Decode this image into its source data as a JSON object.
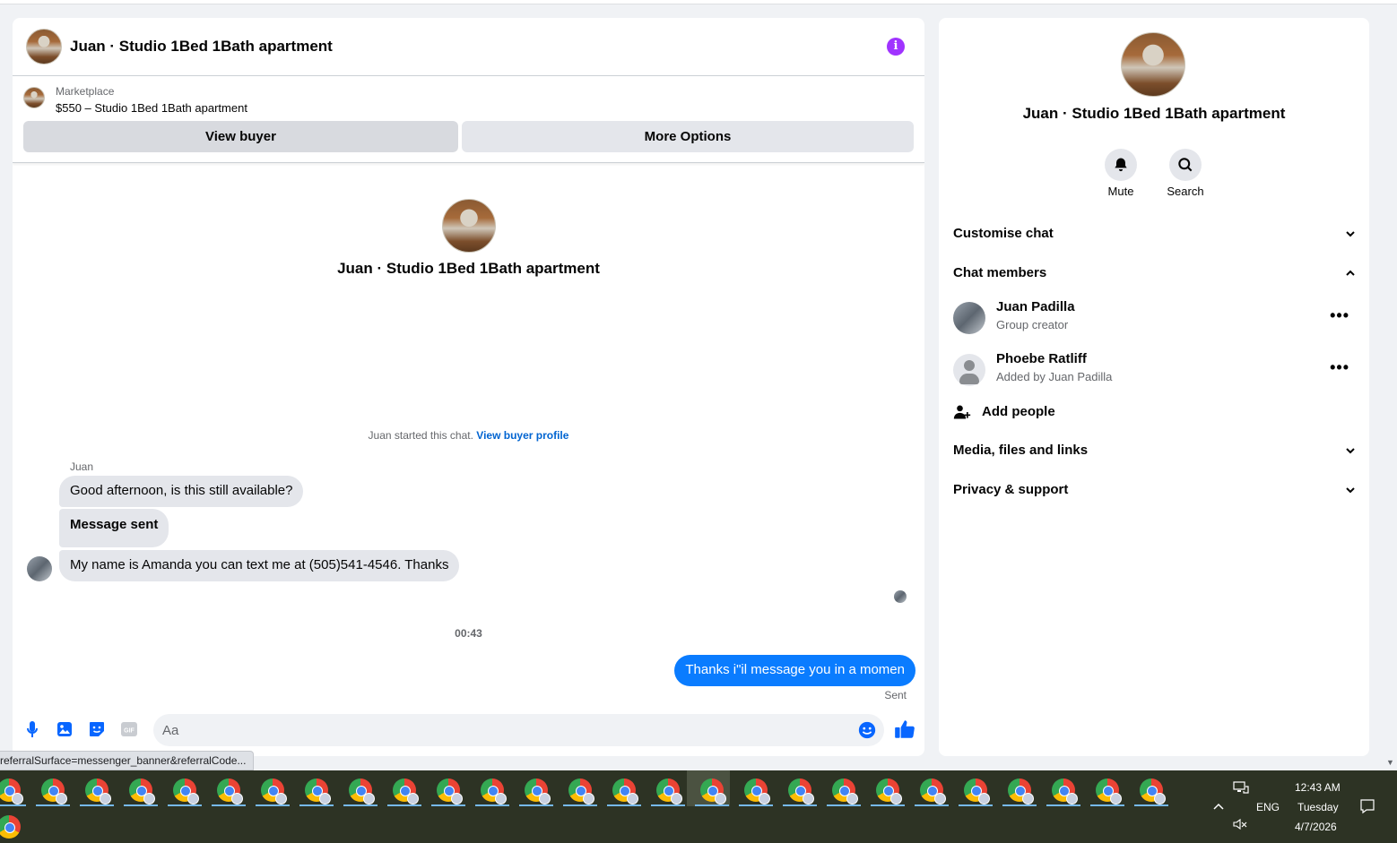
{
  "chat": {
    "title": "Juan · Studio 1Bed 1Bath apartment",
    "info_icon": "i",
    "marketplace_label": "Marketplace",
    "listing": "$550 – Studio 1Bed 1Bath apartment",
    "view_buyer_label": "View buyer",
    "more_options_label": "More Options",
    "intro_title": "Juan · Studio 1Bed 1Bath apartment",
    "started_text": "Juan started this chat.",
    "view_buyer_profile": "View buyer profile",
    "sender_name": "Juan",
    "messages": [
      {
        "text": "Good afternoon, is this still available?"
      },
      {
        "text": "Message sent"
      },
      {
        "text": "My name is Amanda you can text me at (505)541-4546. Thanks"
      }
    ],
    "timestamp": "00:43",
    "outgoing": "Thanks i\"il message you in a momen",
    "sent_label": "Sent",
    "composer_placeholder": "Aa"
  },
  "status_url": "referralSurface=messenger_banner&referralCode...",
  "side": {
    "title": "Juan · Studio 1Bed 1Bath apartment",
    "mute_label": "Mute",
    "search_label": "Search",
    "sections": {
      "customise": "Customise chat",
      "members": "Chat members",
      "media": "Media, files and links",
      "privacy": "Privacy & support"
    },
    "members": [
      {
        "name": "Juan Padilla",
        "sub": "Group creator",
        "more": "•••"
      },
      {
        "name": "Phoebe Ratliff",
        "sub": "Added by Juan Padilla",
        "more": "•••"
      }
    ],
    "add_people": "Add people"
  },
  "taskbar": {
    "lang": "ENG",
    "time": "12:43 AM",
    "day": "Tuesday",
    "date": "4/7/2026"
  },
  "colors": {
    "accent": "#0866ff",
    "outgoing_bubble": "#0a7cff",
    "info": "#a033ff",
    "taskbar": "#2d3324"
  }
}
